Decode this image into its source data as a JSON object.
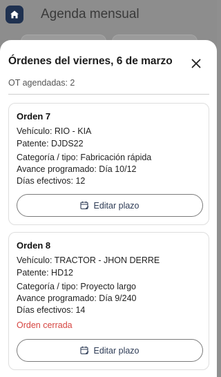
{
  "background": {
    "title": "Agenda mensual"
  },
  "sheet": {
    "title": "Órdenes del viernes, 6 de marzo",
    "subtitle": "OT agendadas: 2"
  },
  "orders": [
    {
      "title": "Orden 7",
      "vehicle": "Vehículo: RIO - KIA",
      "plate": "Patente: DJDS22",
      "category": "Categoría / tipo: Fabricación rápida",
      "progress": "Avance programado: Día 10/12",
      "effective_days": "Días efectivos: 12",
      "edit_label": "Editar plazo"
    },
    {
      "title": "Orden 8",
      "vehicle": "Vehículo: TRACTOR - JHON DERRE",
      "plate": "Patente: HD12",
      "category": "Categoría / tipo: Proyecto largo",
      "progress": "Avance programado: Día 9/240",
      "effective_days": "Días efectivos: 14",
      "status": "Orden cerrada",
      "edit_label": "Editar plazo"
    }
  ],
  "icons": {
    "home": "home-icon",
    "close": "close-icon",
    "calendar": "calendar-edit-icon"
  },
  "colors": {
    "primary": "#1f3150",
    "closed_status": "#d64541",
    "button_text": "#2d3b55"
  }
}
